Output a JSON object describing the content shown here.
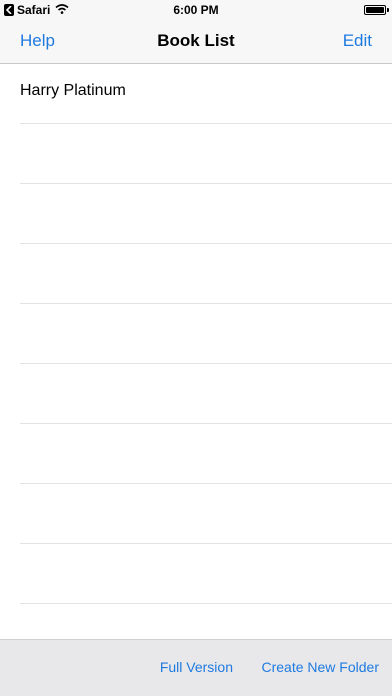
{
  "status_bar": {
    "carrier": "Safari",
    "time": "6:00 PM"
  },
  "nav": {
    "left": "Help",
    "title": "Book List",
    "right": "Edit"
  },
  "list": {
    "items": [
      "Harry Platinum",
      "",
      "",
      "",
      "",
      "",
      "",
      "",
      "",
      ""
    ]
  },
  "toolbar": {
    "full_version": "Full Version",
    "create_folder": "Create New Folder"
  },
  "colors": {
    "accent": "#1f7ae0"
  },
  "icons": [
    "back-chevron-icon",
    "wifi-icon",
    "battery-icon"
  ]
}
